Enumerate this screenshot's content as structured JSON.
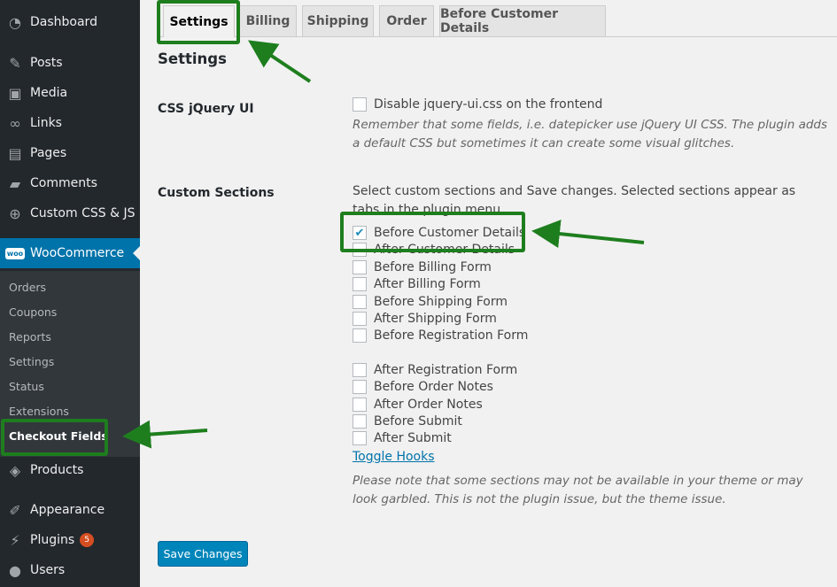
{
  "sidebar": {
    "menu": [
      {
        "label": "Dashboard",
        "icon": "dashboard-icon"
      },
      {
        "label": "Posts",
        "icon": "pin-icon"
      },
      {
        "label": "Media",
        "icon": "media-icon"
      },
      {
        "label": "Links",
        "icon": "link-icon"
      },
      {
        "label": "Pages",
        "icon": "pages-icon"
      },
      {
        "label": "Comments",
        "icon": "comment-icon"
      },
      {
        "label": "Custom CSS & JS",
        "icon": "plus-circle-icon"
      },
      {
        "label": "WooCommerce",
        "icon": "woocommerce-icon"
      },
      {
        "label": "Products",
        "icon": "box-icon"
      },
      {
        "label": "Appearance",
        "icon": "brush-icon"
      },
      {
        "label": "Plugins",
        "icon": "plug-icon",
        "badge": "5"
      },
      {
        "label": "Users",
        "icon": "user-icon"
      }
    ],
    "woo_icon_text": "woo",
    "submenu": [
      "Orders",
      "Coupons",
      "Reports",
      "Settings",
      "Status",
      "Extensions",
      "Checkout Fields"
    ]
  },
  "tabs": [
    "Settings",
    "Billing",
    "Shipping",
    "Order",
    "Before Customer Details"
  ],
  "active_tab": "Settings",
  "page_title": "Settings",
  "css_jquery": {
    "label": "CSS jQuery UI",
    "checkbox_label": "Disable jquery-ui.css on the frontend",
    "description": "Remember that some fields, i.e. datepicker use jQuery UI CSS. The plugin adds a default CSS but sometimes it can create some visual glitches."
  },
  "custom_sections": {
    "label": "Custom Sections",
    "intro": "Select custom sections and Save changes. Selected sections appear as tabs in the plugin menu",
    "options": [
      {
        "label": "Before Customer Details",
        "checked": true
      },
      {
        "label": "After Customer Details",
        "checked": false
      },
      {
        "label": "Before Billing Form",
        "checked": false
      },
      {
        "label": "After Billing Form",
        "checked": false
      },
      {
        "label": "Before Shipping Form",
        "checked": false
      },
      {
        "label": "After Shipping Form",
        "checked": false
      },
      {
        "label": "Before Registration Form",
        "checked": false
      },
      {
        "label": "After Registration Form",
        "checked": false
      },
      {
        "label": "Before Order Notes",
        "checked": false
      },
      {
        "label": "After Order Notes",
        "checked": false
      },
      {
        "label": "Before Submit",
        "checked": false
      },
      {
        "label": "After Submit",
        "checked": false
      }
    ],
    "toggle_link": "Toggle Hooks",
    "note": "Please note that some sections may not be available in your theme or may look garbled. This is not the plugin issue, but the theme issue."
  },
  "save_button": "Save Changes",
  "colors": {
    "sidebar": "#23282d",
    "submenu": "#32373c",
    "accent": "#0073aa",
    "annotation": "#1e7e1e",
    "badge": "#d54e21"
  }
}
